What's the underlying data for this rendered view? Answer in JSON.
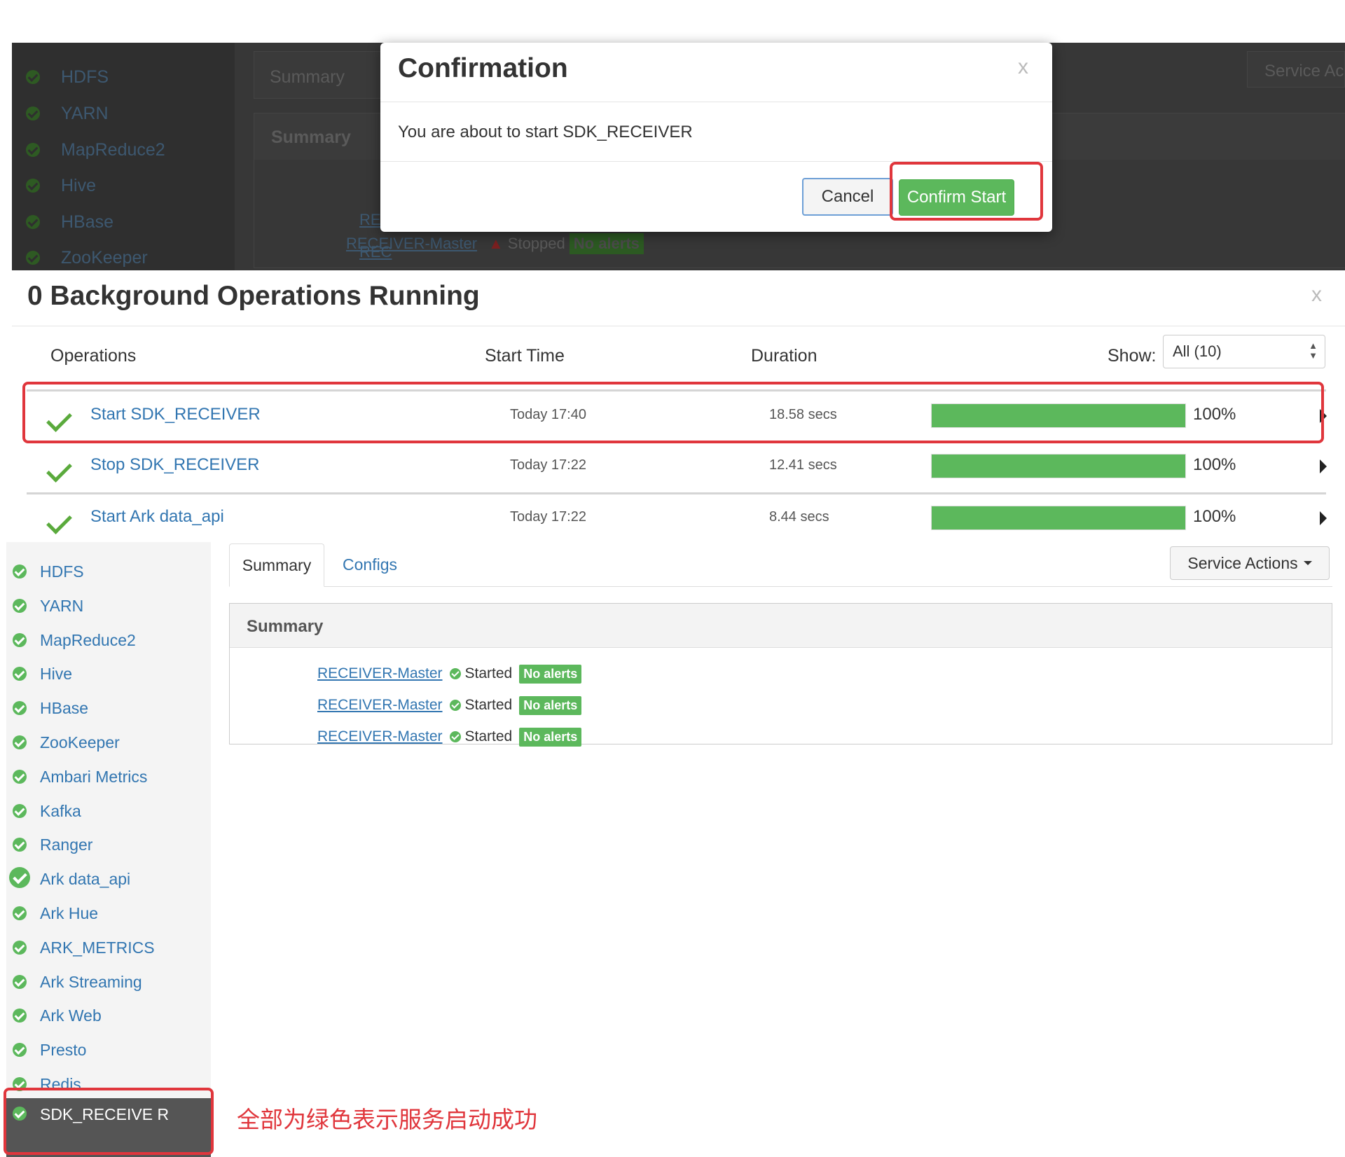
{
  "top_screenshot": {
    "sidebar_items": [
      "HDFS",
      "YARN",
      "MapReduce2",
      "Hive",
      "HBase",
      "ZooKeeper"
    ],
    "tab": "Summary",
    "summary_heading": "Summary",
    "rows": [
      "REC",
      "REC",
      "RECEIVER-Master"
    ],
    "stopped_status": "Stopped",
    "stopped_badge": "No alerts",
    "service_actions": "Service Ac"
  },
  "confirm_dialog": {
    "title": "Confirmation",
    "close": "x",
    "message": "You are about to start SDK_RECEIVER",
    "cancel_label": "Cancel",
    "confirm_label": "Confirm Start"
  },
  "bg_ops": {
    "title": "0 Background Operations Running",
    "close": "x",
    "col_operations": "Operations",
    "col_start_time": "Start Time",
    "col_duration": "Duration",
    "show_label": "Show:",
    "show_value": "All (10)",
    "operations": [
      {
        "name": "Start SDK_RECEIVER",
        "time": "Today 17:40",
        "duration": "18.58 secs",
        "progress": 100,
        "progress_label": "100%"
      },
      {
        "name": "Stop SDK_RECEIVER",
        "time": "Today 17:22",
        "duration": "12.41 secs",
        "progress": 100,
        "progress_label": "100%"
      },
      {
        "name": "Start Ark data_api",
        "time": "Today 17:22",
        "duration": "8.44 secs",
        "progress": 100,
        "progress_label": "100%"
      }
    ]
  },
  "sidebar": {
    "items": [
      "HDFS",
      "YARN",
      "MapReduce2",
      "Hive",
      "HBase",
      "ZooKeeper",
      "Ambari Metrics",
      "Kafka",
      "Ranger",
      "Ark data_api",
      "Ark Hue",
      "ARK_METRICS",
      "Ark Streaming",
      "Ark Web",
      "Presto",
      "Redis"
    ],
    "active_item": "SDK_RECEIVE R"
  },
  "service_panel": {
    "tab_summary": "Summary",
    "tab_configs": "Configs",
    "service_actions": "Service Actions",
    "summary_heading": "Summary",
    "components": [
      {
        "name": "RECEIVER-Master",
        "status": "Started",
        "alerts": "No alerts"
      },
      {
        "name": "RECEIVER-Master",
        "status": "Started",
        "alerts": "No alerts"
      },
      {
        "name": "RECEIVER-Master",
        "status": "Started",
        "alerts": "No alerts"
      }
    ]
  },
  "annotation_note": "全部为绿色表示服务启动成功",
  "colors": {
    "success": "#5cb85c",
    "link": "#3276b1",
    "highlight": "#e0363c"
  }
}
